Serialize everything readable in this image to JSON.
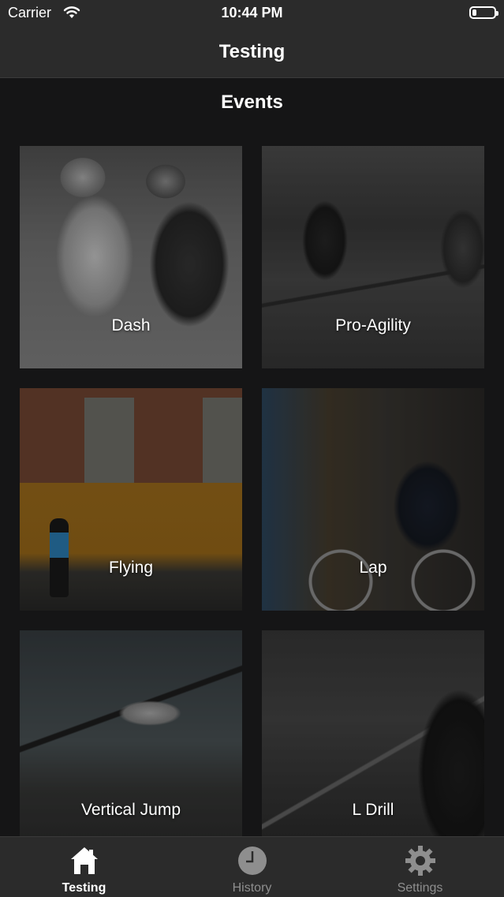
{
  "status_bar": {
    "carrier": "Carrier",
    "time": "10:44 PM",
    "battery_level": 0.3
  },
  "navbar": {
    "title": "Testing"
  },
  "section": {
    "title": "Events"
  },
  "events": [
    {
      "label": "Dash"
    },
    {
      "label": "Pro-Agility"
    },
    {
      "label": "Flying"
    },
    {
      "label": "Lap"
    },
    {
      "label": "Vertical Jump"
    },
    {
      "label": "L Drill"
    }
  ],
  "tabbar": {
    "tabs": [
      {
        "label": "Testing",
        "icon": "home-icon",
        "active": true
      },
      {
        "label": "History",
        "icon": "clock-icon",
        "active": false
      },
      {
        "label": "Settings",
        "icon": "gear-icon",
        "active": false
      }
    ]
  }
}
